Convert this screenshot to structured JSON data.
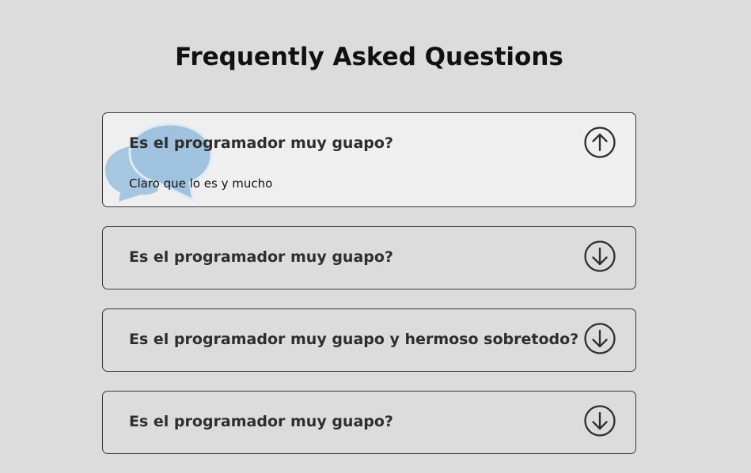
{
  "page": {
    "title": "Frequently Asked Questions"
  },
  "colors": {
    "background": "#dcdcdc",
    "open_item_background": "#efefef",
    "border": "#3a3a3a",
    "bubble": "#9fc2de"
  },
  "faq": {
    "items": [
      {
        "question": "Es el programador muy guapo?",
        "answer": "Claro que lo es y mucho",
        "expanded": true,
        "toggle_icon": "arrow-up-circle-icon"
      },
      {
        "question": "Es el programador muy guapo?",
        "expanded": false,
        "toggle_icon": "arrow-down-circle-icon"
      },
      {
        "question": "Es el programador muy guapo y hermoso sobretodo?",
        "expanded": false,
        "toggle_icon": "arrow-down-circle-icon"
      },
      {
        "question": "Es el programador muy guapo?",
        "expanded": false,
        "toggle_icon": "arrow-down-circle-icon"
      }
    ]
  }
}
